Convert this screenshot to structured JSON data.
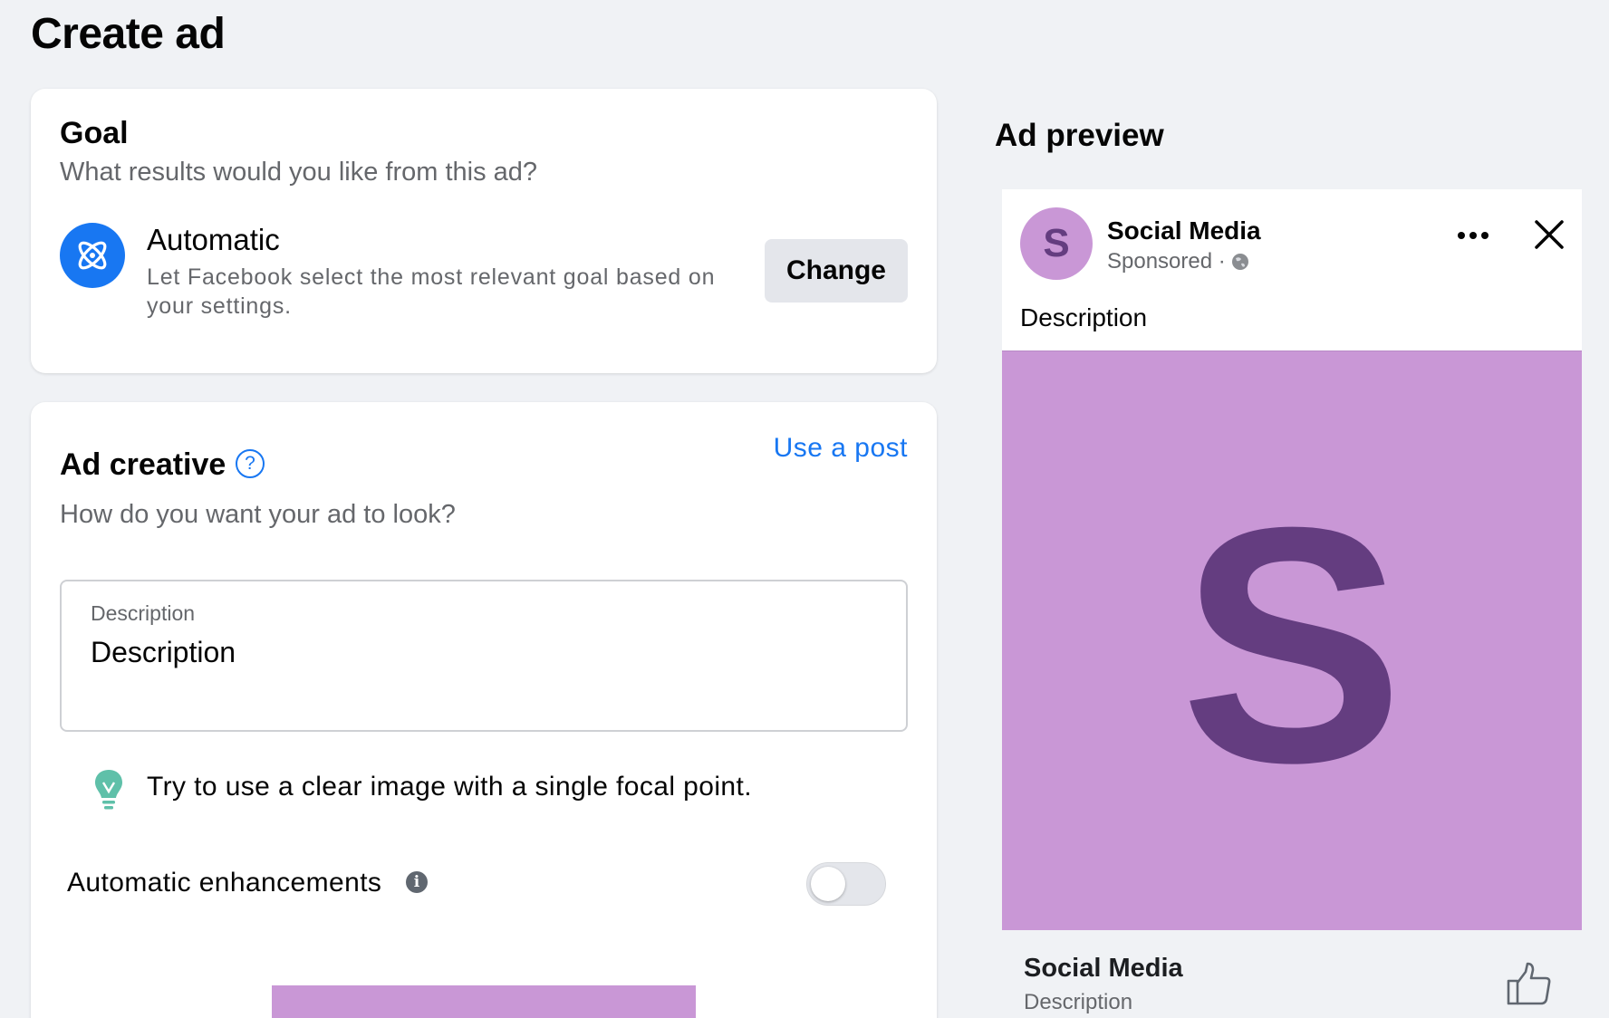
{
  "page": {
    "title": "Create ad"
  },
  "goal": {
    "heading": "Goal",
    "subheading": "What results would you like from this ad?",
    "option_name": "Automatic",
    "option_description": "Let Facebook select the most relevant goal based on your settings.",
    "change_label": "Change",
    "icon": "atom-icon"
  },
  "creative": {
    "heading": "Ad creative",
    "help_icon": "?",
    "use_post_label": "Use a post",
    "subheading": "How do you want your ad to look?",
    "description_field": {
      "label": "Description",
      "value": "Description"
    },
    "tip": "Try to use a clear image with a single focal point.",
    "enhancements_label": "Automatic enhancements",
    "info_icon": "i",
    "enhancements_enabled": false
  },
  "preview": {
    "heading": "Ad preview",
    "page_initial": "S",
    "page_name": "Social Media",
    "sponsored_label": "Sponsored ·",
    "post_text": "Description",
    "image_letter": "S",
    "footer_name": "Social Media",
    "footer_description": "Description"
  },
  "colors": {
    "accent": "#1877f2",
    "brand_purple": "#c997d6",
    "brand_purple_dark": "#643d80",
    "background": "#f0f2f5"
  }
}
